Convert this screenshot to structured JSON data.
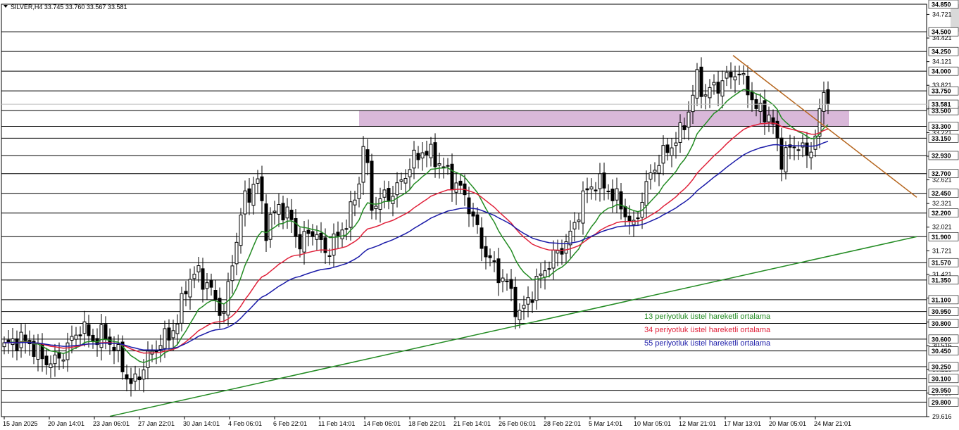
{
  "chart_data": {
    "type": "candlestick",
    "title": "SILVER,H4  33.745 33.760 33.567 33.581",
    "symbol": "SILVER",
    "timeframe": "H4",
    "ohlc_header": {
      "open": 33.745,
      "high": 33.76,
      "low": 33.567,
      "close": 33.581
    },
    "ylim": [
      29.616,
      34.85
    ],
    "y_ticks": [
      "34.721",
      "34.421",
      "34.121",
      "33.821",
      "33.521",
      "33.221",
      "32.921",
      "32.621",
      "32.321",
      "32.021",
      "31.721",
      "31.421",
      "31.121",
      "30.816",
      "30.516",
      "30.216",
      "29.916",
      "29.616"
    ],
    "x_ticks": [
      "15 Jan 2025",
      "20 Jan 14:01",
      "23 Jan 06:01",
      "27 Jan 22:01",
      "30 Jan 14:01",
      "4 Feb 06:01",
      "6 Feb 22:01",
      "11 Feb 14:01",
      "14 Feb 06:01",
      "18 Feb 22:01",
      "21 Feb 14:01",
      "26 Feb 06:01",
      "28 Feb 22:01",
      "5 Mar 14:01",
      "10 Mar 05:01",
      "12 Mar 21:01",
      "17 Mar 13:01",
      "20 Mar 05:01",
      "24 Mar 21:01"
    ],
    "horizontal_levels": [
      34.85,
      34.5,
      34.25,
      34.0,
      33.75,
      33.5,
      33.3,
      33.15,
      32.93,
      32.7,
      32.45,
      32.2,
      31.9,
      31.57,
      31.35,
      31.1,
      30.95,
      30.8,
      30.6,
      30.45,
      30.25,
      30.1,
      29.95,
      29.8
    ],
    "level_labels": [
      "34.850",
      "34.500",
      "34.250",
      "34.000",
      "33.750",
      "33.500",
      "33.300",
      "33.150",
      "32.930",
      "32.700",
      "32.450",
      "32.200",
      "31.900",
      "31.570",
      "31.350",
      "31.100",
      "30.950",
      "30.800",
      "30.600",
      "30.450",
      "30.250",
      "30.100",
      "29.950",
      "29.800"
    ],
    "current_price": {
      "value": 33.581,
      "label": "33.581"
    },
    "zones": [
      {
        "color": "#d9d9d9",
        "y_range": [
          34.5,
          34.85
        ],
        "x_range_index": [
          224,
          252
        ]
      },
      {
        "color": "#d9b8d9",
        "y_range": [
          33.3,
          33.5
        ],
        "x_range_index": [
          84,
          200
        ]
      }
    ],
    "trendlines": [
      {
        "color": "#b5651d",
        "from": {
          "index": 172.5,
          "price": 34.2
        },
        "to": {
          "index": 216,
          "price": 32.4
        }
      },
      {
        "color": "#228b22",
        "from": {
          "index": 25,
          "price": 29.62
        },
        "to": {
          "index": 216,
          "price": 31.9
        }
      }
    ],
    "legend": [
      {
        "label": "13 periyotluk üstel hareketli ortalama",
        "color": "#228b22"
      },
      {
        "label": "34 periyotluk üstel hareketli ortalama",
        "color": "#e0213a"
      },
      {
        "label": "55 periyotluk üstel hareketli ortalama",
        "color": "#1a1aa8"
      }
    ],
    "ema_periods": [
      13,
      34,
      55
    ],
    "close_anchors": [
      [
        0,
        30.5
      ],
      [
        3,
        30.6
      ],
      [
        6,
        30.55
      ],
      [
        9,
        30.35
      ],
      [
        12,
        30.3
      ],
      [
        15,
        30.5
      ],
      [
        18,
        30.75
      ],
      [
        21,
        30.6
      ],
      [
        24,
        30.65
      ],
      [
        27,
        30.4
      ],
      [
        30,
        30.0
      ],
      [
        33,
        30.25
      ],
      [
        35,
        30.45
      ],
      [
        38,
        30.6
      ],
      [
        41,
        30.8
      ],
      [
        43,
        31.3
      ],
      [
        46,
        31.45
      ],
      [
        49,
        31.2
      ],
      [
        52,
        30.9
      ],
      [
        54,
        31.6
      ],
      [
        57,
        32.4
      ],
      [
        60,
        32.6
      ],
      [
        62,
        32.0
      ],
      [
        65,
        32.3
      ],
      [
        68,
        32.1
      ],
      [
        70,
        31.8
      ],
      [
        73,
        32.0
      ],
      [
        76,
        31.7
      ],
      [
        79,
        31.9
      ],
      [
        82,
        32.2
      ],
      [
        84,
        32.6
      ],
      [
        85,
        33.1
      ],
      [
        87,
        32.3
      ],
      [
        90,
        32.4
      ],
      [
        93,
        32.5
      ],
      [
        96,
        32.8
      ],
      [
        99,
        33.0
      ],
      [
        102,
        32.9
      ],
      [
        105,
        32.7
      ],
      [
        108,
        32.5
      ],
      [
        110,
        32.3
      ],
      [
        113,
        31.8
      ],
      [
        116,
        31.5
      ],
      [
        119,
        31.3
      ],
      [
        122,
        30.9
      ],
      [
        125,
        31.2
      ],
      [
        128,
        31.5
      ],
      [
        131,
        31.7
      ],
      [
        134,
        31.9
      ],
      [
        137,
        32.4
      ],
      [
        140,
        32.6
      ],
      [
        143,
        32.5
      ],
      [
        146,
        32.3
      ],
      [
        149,
        32.0
      ],
      [
        151,
        32.4
      ],
      [
        154,
        32.8
      ],
      [
        157,
        33.0
      ],
      [
        160,
        33.2
      ],
      [
        162,
        33.5
      ],
      [
        164,
        33.9
      ],
      [
        166,
        33.7
      ],
      [
        168,
        33.8
      ],
      [
        171,
        33.9
      ],
      [
        173,
        34.0
      ],
      [
        176,
        33.8
      ],
      [
        178,
        33.5
      ],
      [
        180,
        33.5
      ],
      [
        182,
        33.3
      ],
      [
        184,
        32.9
      ],
      [
        186,
        33.0
      ],
      [
        188,
        33.1
      ],
      [
        190,
        32.9
      ],
      [
        192,
        33.2
      ],
      [
        194,
        33.7
      ],
      [
        195,
        33.58
      ]
    ],
    "candle_count": 196
  }
}
